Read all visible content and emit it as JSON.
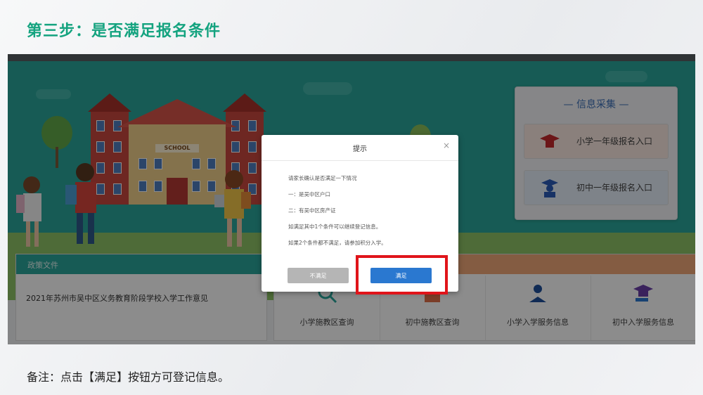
{
  "slide": {
    "title": "第三步：是否满足报名条件",
    "note": "备注：点击【满足】按钮方可登记信息。"
  },
  "banner": {
    "school_sign": "SCHOOL"
  },
  "info_panel": {
    "title": "— 信息采集 —",
    "entries": [
      {
        "label": "小学一年级报名入口",
        "icon": "graduation-cap-icon",
        "bg": "#fbe9e2"
      },
      {
        "label": "初中一年级报名入口",
        "icon": "graduate-student-icon",
        "bg": "#e6eef9"
      }
    ]
  },
  "policy": {
    "header": "政策文件",
    "items": [
      "2021年苏州市吴中区义务教育阶段学校入学工作意见"
    ]
  },
  "services": {
    "items": [
      {
        "label": "小学施教区查询",
        "icon": "search-magnifier-icon"
      },
      {
        "label": "初中施教区查询",
        "icon": "map-building-icon"
      },
      {
        "label": "小学入学服务信息",
        "icon": "reading-person-icon"
      },
      {
        "label": "初中入学服务信息",
        "icon": "diploma-cap-icon"
      }
    ]
  },
  "modal": {
    "title": "提示",
    "close": "×",
    "lines": [
      "请家长确认是否满足一下情况",
      "一：是吴中区户口",
      "二：有吴中区房产证",
      "如满足其中1个条件可以继续登记信息。",
      "如果2个条件都不满足，请参加积分入学。"
    ],
    "cancel_label": "不满足",
    "confirm_label": "满足"
  },
  "colors": {
    "title_green": "#14a37f",
    "teal": "#2aa79b",
    "primary_blue": "#2a78d0",
    "highlight_red": "#e0141a"
  }
}
